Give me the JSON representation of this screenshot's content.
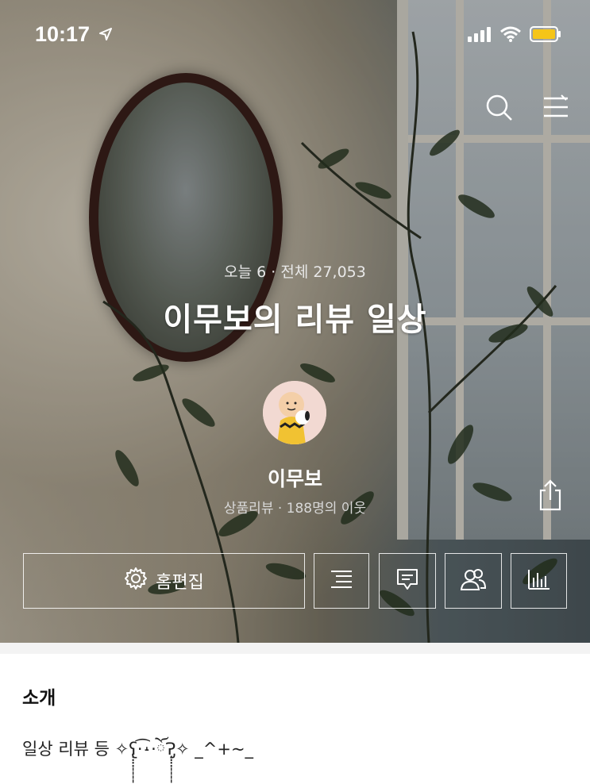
{
  "status_bar": {
    "time": "10:17"
  },
  "blog": {
    "stats": "오늘 6 · 전체 27,053",
    "title": "이무보의 리뷰 일상",
    "nickname": "이무보",
    "subtitle": "상품리뷰 · 188명의 이웃"
  },
  "actions": {
    "edit_label": "홈편집"
  },
  "intro": {
    "title": "소개",
    "text": "일상 리뷰 등  ✧ʕ̢̣̣̣̣̩̩̩̩·͡˔·ོɁ̡̣̣̣̣̩̩̩̩✧ _^+~_"
  },
  "icons": {
    "status": [
      "location-arrow-icon",
      "signal-icon",
      "wifi-icon",
      "battery-icon"
    ],
    "header": [
      "search-icon",
      "menu-icon",
      "share-icon"
    ],
    "buttons": [
      "gear-icon",
      "list-icon",
      "comment-icon",
      "users-icon",
      "stats-icon"
    ]
  },
  "colors": {
    "battery": "#f5c518",
    "gap": "#f3f3f3"
  }
}
